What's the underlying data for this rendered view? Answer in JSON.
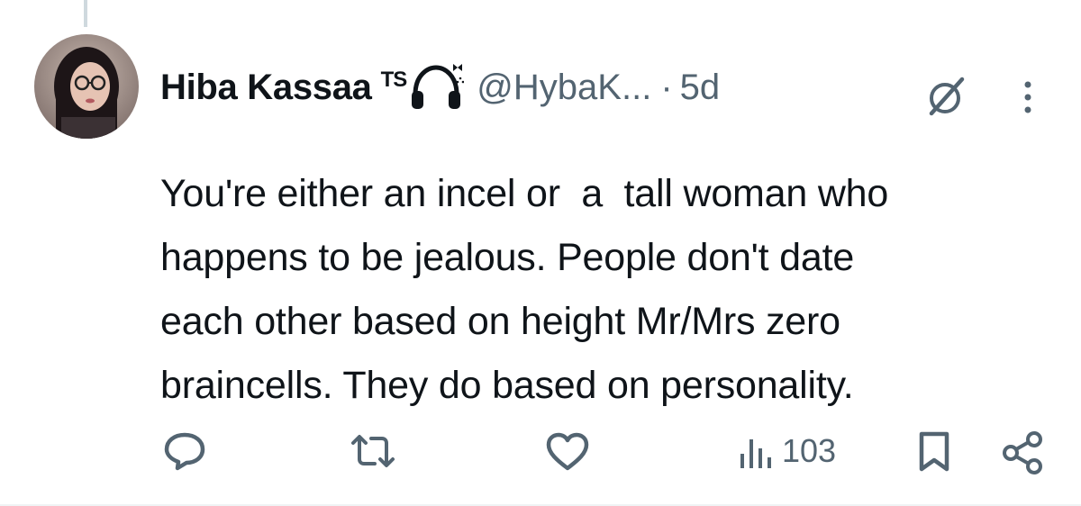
{
  "tweet": {
    "display_name": "Hiba Kassaa",
    "name_tag": "TS",
    "handle": "@HybaK...",
    "separator": "·",
    "time": "5d",
    "text": "You're either an incel or  a  tall woman who\nhappens to be jealous. People don't date\neach other based on height Mr/Mrs zero\nbraincells. They do based on personality.",
    "views": "103"
  },
  "icons": {
    "avatar": "avatar",
    "grok": "grok-icon",
    "more": "more-icon",
    "reply": "reply-icon",
    "retweet": "retweet-icon",
    "like": "like-icon",
    "views": "views-icon",
    "bookmark": "bookmark-icon",
    "share": "share-icon",
    "headphones": "headphones-icon"
  },
  "colors": {
    "text": "#0f1419",
    "secondary": "#536471",
    "divider": "#eff3f4"
  }
}
